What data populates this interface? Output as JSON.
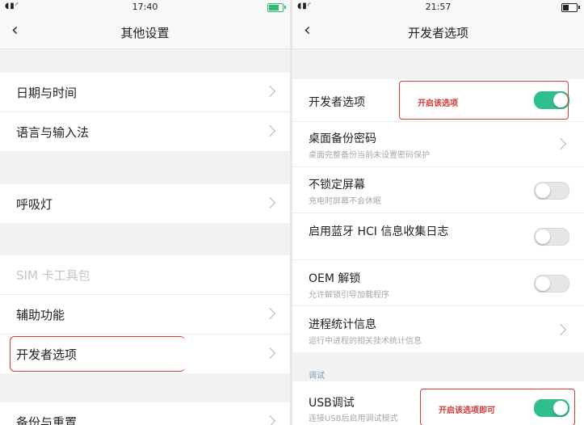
{
  "left": {
    "status": {
      "time": "17:40"
    },
    "header": {
      "back_icon": "chevron-left-icon",
      "title": "其他设置"
    },
    "items": [
      {
        "label": "日期与时间"
      },
      {
        "label": "语言与输入法"
      },
      {
        "label": "呼吸灯"
      },
      {
        "label": "SIM 卡工具包",
        "disabled": true
      },
      {
        "label": "辅助功能"
      },
      {
        "label": "开发者选项"
      },
      {
        "label": "备份与重置"
      }
    ]
  },
  "right": {
    "status": {
      "time": "21:57"
    },
    "header": {
      "back_icon": "chevron-left-icon",
      "title": "开发者选项"
    },
    "items": [
      {
        "label": "开发者选项",
        "control": "toggle",
        "on": true
      },
      {
        "label": "桌面备份密码",
        "subtitle": "桌面完整备份当前未设置密码保护",
        "control": "chevron"
      },
      {
        "label": "不锁定屏幕",
        "subtitle": "充电时屏幕不会休眠",
        "control": "toggle",
        "on": false
      },
      {
        "label": "启用蓝牙 HCI 信息收集日志",
        "control": "toggle",
        "on": false
      },
      {
        "label": "OEM 解锁",
        "subtitle": "允许解锁引导加载程序",
        "control": "toggle",
        "on": false
      },
      {
        "label": "进程统计信息",
        "subtitle": "运行中进程的相关技术统计信息",
        "control": "chevron"
      }
    ],
    "section_debug": "调试",
    "usb_debug": {
      "label": "USB调试",
      "subtitle": "连接USB后启用调试模式",
      "control": "toggle",
      "on": true
    }
  },
  "annotations": {
    "enable_option": "开启该选项",
    "enable_option_done": "开启该选项即可"
  },
  "colors": {
    "toggle_on": "#2fbf8f",
    "annotation_red": "#d43838"
  }
}
